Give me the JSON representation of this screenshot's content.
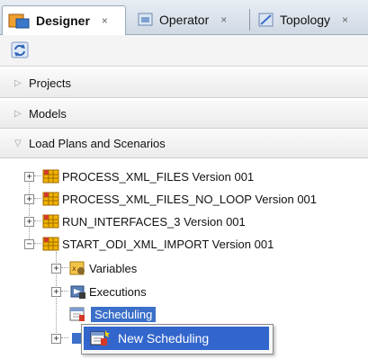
{
  "tabs": [
    {
      "label": "Designer",
      "close": "×",
      "icon": "designer-icon",
      "active": true
    },
    {
      "label": "Operator",
      "close": "×",
      "icon": "operator-icon",
      "active": false
    },
    {
      "label": "Topology",
      "close": "×",
      "icon": "topology-icon",
      "active": false
    }
  ],
  "toolbar": {
    "icon": "refresh-icon"
  },
  "accordions": [
    {
      "label": "Projects",
      "expanded": false
    },
    {
      "label": "Models",
      "expanded": false
    },
    {
      "label": "Load Plans and Scenarios",
      "expanded": true
    }
  ],
  "tree": {
    "scenarios": [
      {
        "label": "PROCESS_XML_FILES Version 001",
        "expander": "+"
      },
      {
        "label": "PROCESS_XML_FILES_NO_LOOP Version 001",
        "expander": "+"
      },
      {
        "label": "RUN_INTERFACES_3 Version 001",
        "expander": "+"
      },
      {
        "label": "START_ODI_XML_IMPORT Version 001",
        "expander": "−"
      }
    ],
    "children": [
      {
        "label": "Variables",
        "expander": "+",
        "icon": "variables-icon"
      },
      {
        "label": "Executions",
        "expander": "+",
        "icon": "executions-icon"
      },
      {
        "label": "Scheduling",
        "expander": "",
        "icon": "scheduling-icon",
        "selected": true
      }
    ]
  },
  "context_menu": {
    "items": [
      {
        "label": "New Scheduling",
        "icon": "new-scheduling-icon"
      }
    ]
  },
  "colors": {
    "selection": "#3b6fc9",
    "menu_highlight": "#3366cc",
    "scenario_icon": "#f0b400"
  }
}
